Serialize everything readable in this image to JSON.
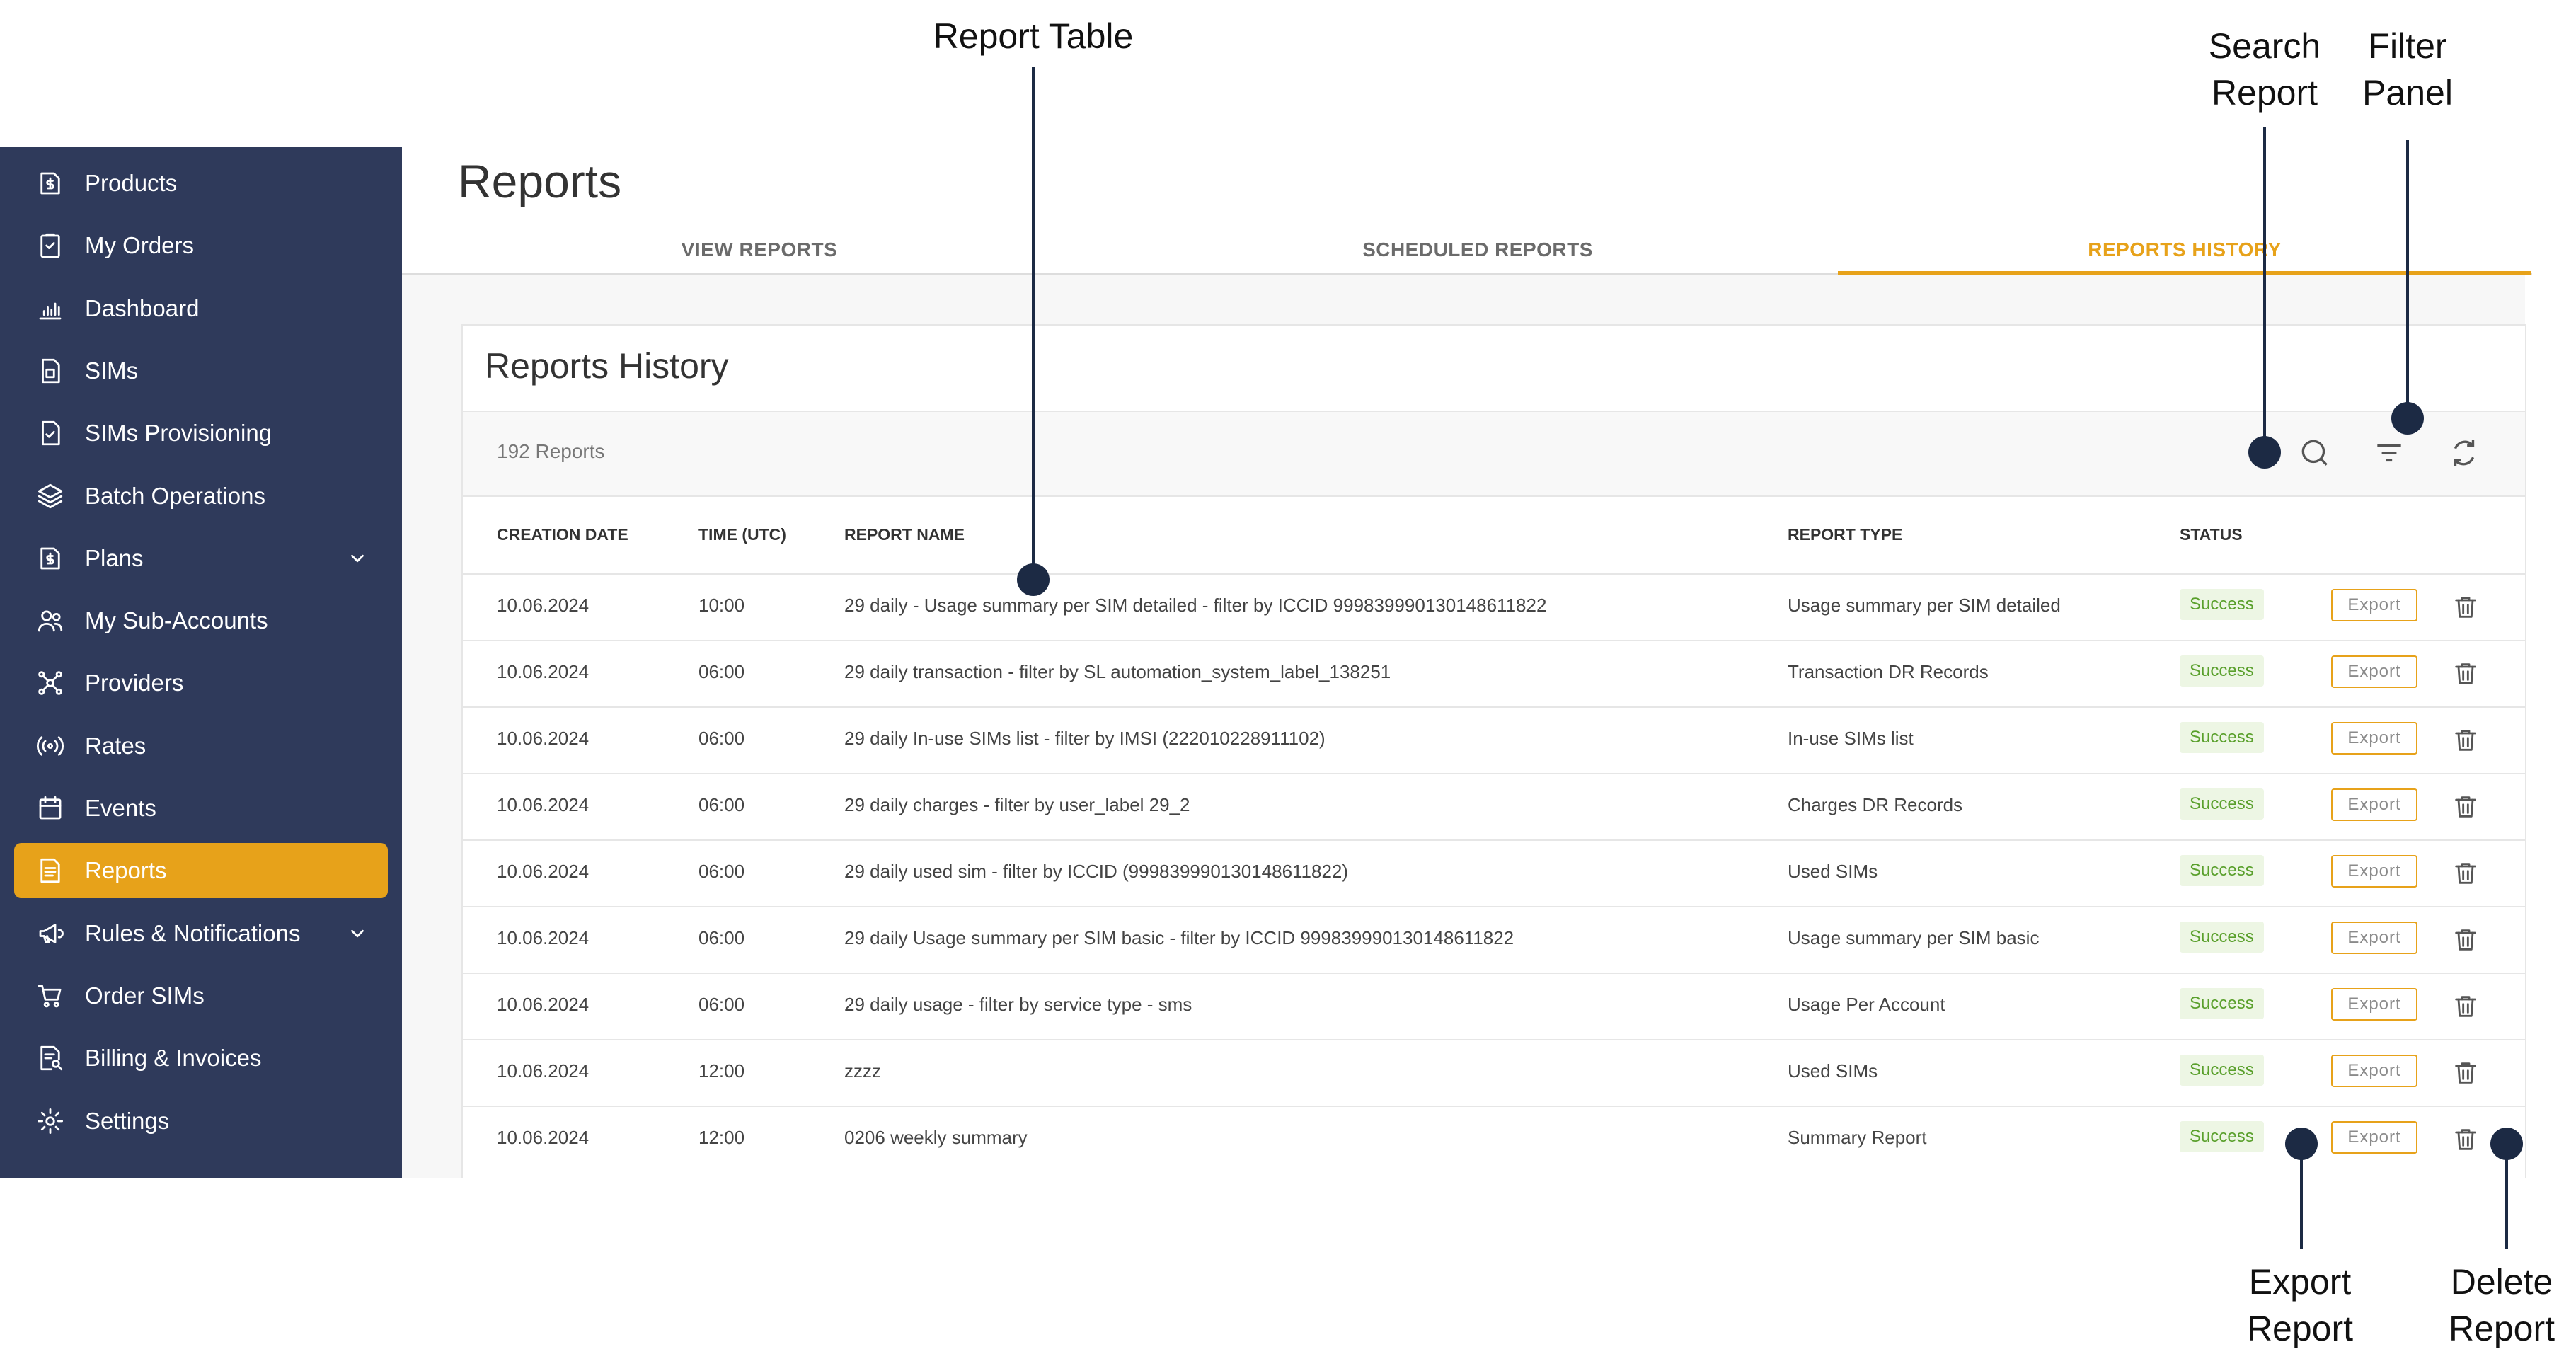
{
  "sidebar": {
    "items": [
      {
        "label": "Products",
        "icon": "dollar-document-icon"
      },
      {
        "label": "My Orders",
        "icon": "checklist-icon"
      },
      {
        "label": "Dashboard",
        "icon": "bar-chart-icon"
      },
      {
        "label": "SIMs",
        "icon": "sim-card-icon"
      },
      {
        "label": "SIMs Provisioning",
        "icon": "sim-check-icon"
      },
      {
        "label": "Batch Operations",
        "icon": "layers-icon"
      },
      {
        "label": "Plans",
        "icon": "dollar-plan-icon"
      },
      {
        "label": "My Sub-Accounts",
        "icon": "users-icon"
      },
      {
        "label": "Providers",
        "icon": "network-icon"
      },
      {
        "label": "Rates",
        "icon": "signal-icon"
      },
      {
        "label": "Events",
        "icon": "calendar-icon"
      },
      {
        "label": "Reports",
        "icon": "report-icon"
      },
      {
        "label": "Rules & Notifications",
        "icon": "megaphone-icon"
      },
      {
        "label": "Order SIMs",
        "icon": "cart-icon"
      },
      {
        "label": "Billing & Invoices",
        "icon": "invoice-search-icon"
      },
      {
        "label": "Settings",
        "icon": "gear-icon"
      }
    ],
    "active": "Reports"
  },
  "header": {
    "title": "Reports",
    "tabs": [
      "VIEW REPORTS",
      "SCHEDULED REPORTS",
      "REPORTS HISTORY"
    ],
    "active_tab": "REPORTS HISTORY"
  },
  "card": {
    "title": "Reports History",
    "count": "192 Reports"
  },
  "table": {
    "columns": [
      "CREATION DATE",
      "TIME (UTC)",
      "REPORT NAME",
      "REPORT TYPE",
      "STATUS"
    ],
    "export_label": "Export",
    "rows": [
      {
        "date": "10.06.2024",
        "time": "10:00",
        "name": "29 daily - Usage summary per SIM detailed - filter by ICCID 999839990130148611822",
        "type": "Usage summary per SIM detailed",
        "status": "Success"
      },
      {
        "date": "10.06.2024",
        "time": "06:00",
        "name": "29 daily transaction - filter by SL automation_system_label_138251",
        "type": "Transaction DR Records",
        "status": "Success"
      },
      {
        "date": "10.06.2024",
        "time": "06:00",
        "name": "29 daily In-use SIMs list - filter by IMSI (222010228911102)",
        "type": "In-use SIMs list",
        "status": "Success"
      },
      {
        "date": "10.06.2024",
        "time": "06:00",
        "name": "29 daily charges - filter by user_label 29_2",
        "type": "Charges DR Records",
        "status": "Success"
      },
      {
        "date": "10.06.2024",
        "time": "06:00",
        "name": "29 daily used sim - filter by ICCID (999839990130148611822)",
        "type": "Used SIMs",
        "status": "Success"
      },
      {
        "date": "10.06.2024",
        "time": "06:00",
        "name": "29 daily Usage summary per SIM basic - filter by ICCID 999839990130148611822",
        "type": "Usage summary per SIM basic",
        "status": "Success"
      },
      {
        "date": "10.06.2024",
        "time": "06:00",
        "name": "29 daily usage - filter by service type - sms",
        "type": "Usage Per Account",
        "status": "Success"
      },
      {
        "date": "10.06.2024",
        "time": "12:00",
        "name": "zzzz",
        "type": "Used SIMs",
        "status": "Success"
      },
      {
        "date": "10.06.2024",
        "time": "12:00",
        "name": "0206 weekly summary",
        "type": "Summary Report",
        "status": "Success"
      }
    ]
  },
  "toolbar_icons": [
    "search-icon",
    "filter-icon",
    "refresh-icon"
  ],
  "annotations": {
    "report_table": "Report Table",
    "search_report_1": "Search",
    "search_report_2": "Report",
    "filter_panel_1": "Filter",
    "filter_panel_2": "Panel",
    "export_report_1": "Export",
    "export_report_2": "Report",
    "delete_report_1": "Delete",
    "delete_report_2": "Report"
  },
  "colors": {
    "sidebar_bg": "#2f3a5b",
    "accent": "#e7a21a",
    "success_text": "#5aa02c",
    "success_bg": "#edf6e4",
    "annotation": "#1c2a44"
  }
}
